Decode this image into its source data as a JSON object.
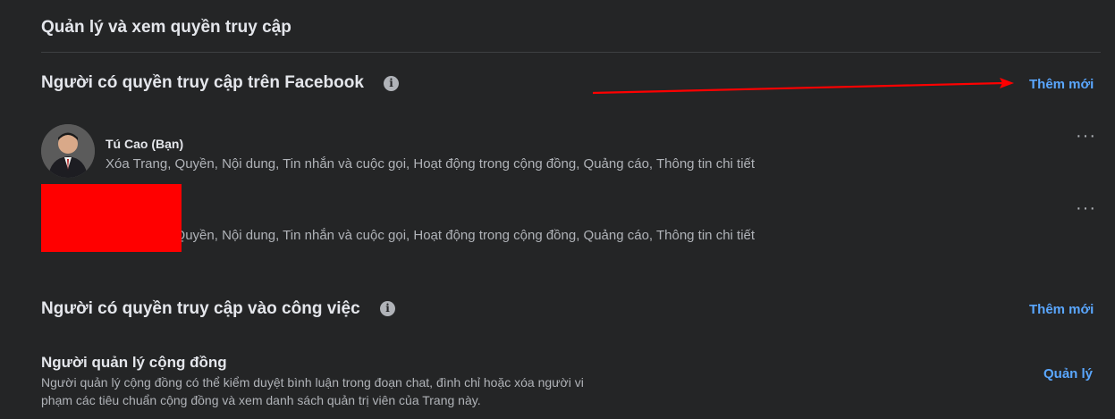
{
  "page": {
    "title": "Quản lý và xem quyền truy cập"
  },
  "facebook_access": {
    "heading": "Người có quyền truy cập trên Facebook",
    "add_label": "Thêm mới",
    "members": [
      {
        "name": "Tú Cao (Bạn)",
        "permissions": "Xóa Trang, Quyền, Nội dung, Tin nhắn và cuộc gọi, Hoạt động trong cộng đồng, Quảng cáo, Thông tin chi tiết",
        "more_label": "···"
      },
      {
        "name": "",
        "permissions": "Xóa Trang, Quyền, Nội dung, Tin nhắn và cuộc gọi, Hoạt động trong cộng đồng, Quảng cáo, Thông tin chi tiết",
        "more_label": "···"
      }
    ]
  },
  "task_access": {
    "heading": "Người có quyền truy cập vào công việc",
    "add_label": "Thêm mới"
  },
  "community_manager": {
    "title": "Người quản lý cộng đồng",
    "description": "Người quản lý cộng đồng có thể kiểm duyệt bình luận trong đoạn chat, đình chỉ hoặc xóa người vi phạm các tiêu chuẩn cộng đồng và xem danh sách quản trị viên của Trang này.",
    "manage_label": "Quản lý"
  },
  "icons": {
    "info": "info-icon",
    "more": "more-horizontal-icon",
    "annotation": "red-arrow-annotation"
  },
  "colors": {
    "background": "#242526",
    "link": "#5aa7ff",
    "annotation": "#ff0000"
  }
}
